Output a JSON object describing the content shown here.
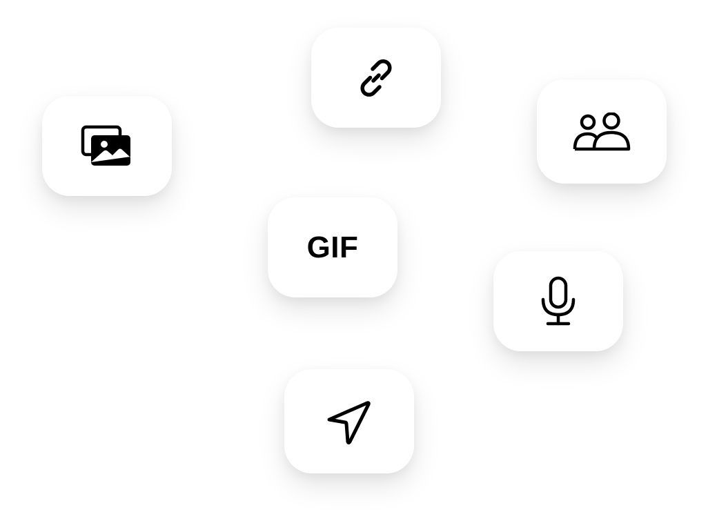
{
  "tiles": {
    "images": {
      "icon": "images-icon"
    },
    "link": {
      "icon": "link-icon"
    },
    "people": {
      "icon": "people-icon"
    },
    "gif": {
      "label": "GIF"
    },
    "microphone": {
      "icon": "microphone-icon"
    },
    "location": {
      "icon": "location-arrow-icon"
    }
  },
  "colors": {
    "background": "#ffffff",
    "tile": "#ffffff",
    "icon": "#000000"
  }
}
